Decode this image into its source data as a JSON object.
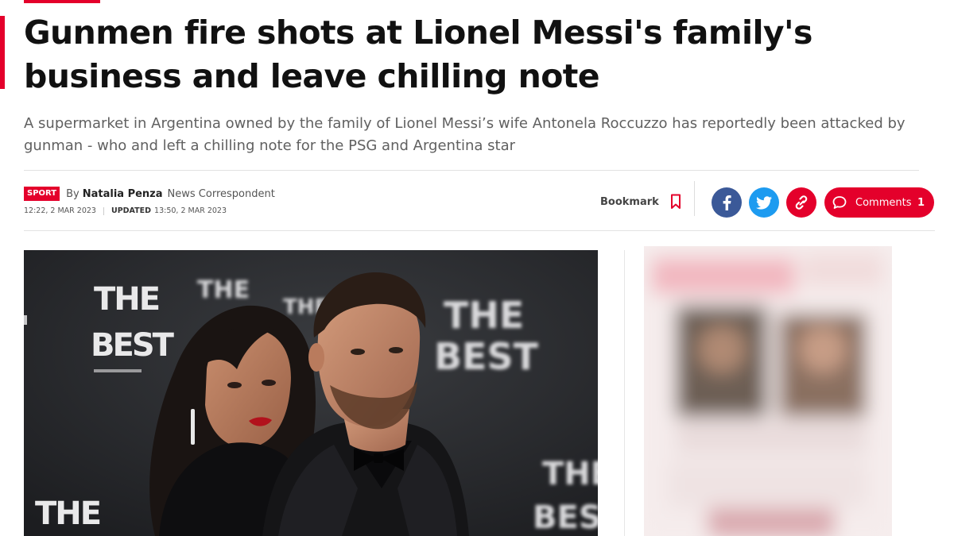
{
  "article": {
    "headline": "Gunmen fire shots at Lionel Messi's family's business and leave chilling note",
    "standfirst": "A supermarket in Argentina owned by the family of Lionel Messi’s wife Antonela Roccuzzo has reportedly been attacked by gunman - who and left a chilling note for the PSG and Argentina star",
    "section_tag": "SPORT",
    "by_prefix": "By",
    "author": "Natalia Penza",
    "author_role": "News Correspondent",
    "published": "12:22, 2 MAR 2023",
    "updated_label": "UPDATED",
    "updated": "13:50, 2 MAR 2023"
  },
  "actions": {
    "bookmark_label": "Bookmark",
    "comments_label": "Comments",
    "comments_count": "1"
  },
  "hero_image": {
    "backdrop_text": [
      "THE",
      "BEST"
    ]
  },
  "colors": {
    "accent": "#e4002b",
    "facebook": "#3b5998",
    "twitter": "#1d9bf0",
    "standfirst_text": "#606060",
    "headline_text": "#111111"
  },
  "icons": [
    "facebook-icon",
    "twitter-icon",
    "link-icon",
    "bookmark-icon",
    "comment-icon"
  ]
}
